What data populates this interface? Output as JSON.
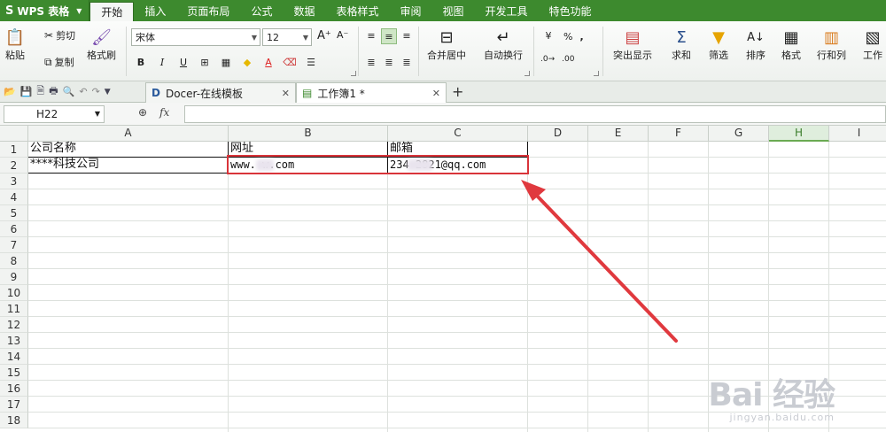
{
  "app": {
    "name": "WPS 表格",
    "logo": "S"
  },
  "menu": [
    "开始",
    "插入",
    "页面布局",
    "公式",
    "数据",
    "表格样式",
    "审阅",
    "视图",
    "开发工具",
    "特色功能"
  ],
  "menu_active": 0,
  "ribbon": {
    "paste": "粘贴",
    "cut": "剪切",
    "copy": "复制",
    "format_painter": "格式刷",
    "font_name": "宋体",
    "font_size": "12",
    "grow_font": "A⁺",
    "shrink_font": "A⁻",
    "bold": "B",
    "italic": "I",
    "underline": "U",
    "merge_center": "合并居中",
    "wrap_text": "自动换行",
    "percent": "%",
    "comma": ",",
    "conditional_format": "突出显示",
    "sum": "求和",
    "filter": "筛选",
    "sort": "排序",
    "format": "格式",
    "row_col": "行和列",
    "worksheet": "工作"
  },
  "tabs": [
    {
      "label": "Docer-在线模板",
      "icon": "docer-icon"
    },
    {
      "label": "工作簿1 *",
      "icon": "sheet-icon"
    }
  ],
  "formula_bar": {
    "cell_ref": "H22",
    "fx": "fx",
    "value": ""
  },
  "columns": [
    "A",
    "B",
    "C",
    "D",
    "E",
    "F",
    "G",
    "H",
    "I"
  ],
  "selected_column": "H",
  "rows": [
    "1",
    "2",
    "3",
    "4",
    "5",
    "6",
    "7",
    "8",
    "9",
    "10",
    "11",
    "12",
    "13",
    "14",
    "15",
    "16",
    "17",
    "18"
  ],
  "cells": {
    "A1": "公司名称",
    "B1": "网址",
    "C1": "邮箱",
    "A2": "****科技公司",
    "B2": "www.  w.com",
    "C2": "234   2821@qq.com"
  },
  "watermark": {
    "brand": "Bai 经验",
    "url": "jingyan.baidu.com"
  },
  "colors": {
    "menubar": "#3d8a2e",
    "highlight": "#d9343a",
    "arrow": "#e0393e"
  }
}
